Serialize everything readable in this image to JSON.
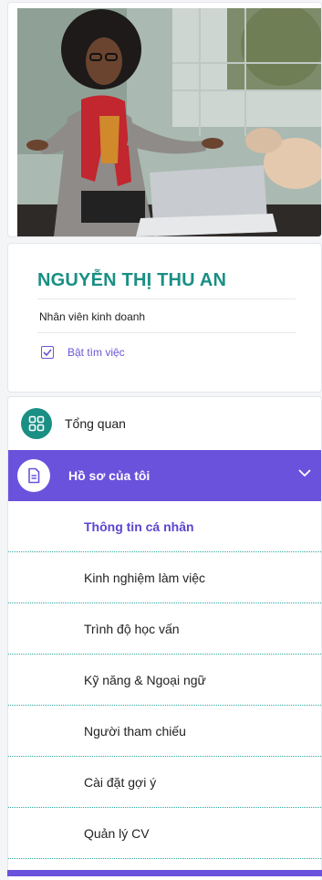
{
  "profile": {
    "name": "NGUYỄN THỊ THU AN",
    "job_title": "Nhân viên kinh doanh",
    "job_search_label": "Bật tìm việc",
    "job_search_enabled": true
  },
  "menu": {
    "overview_label": "Tổng quan",
    "my_profile_label": "Hồ sơ của tôi",
    "sub_items": [
      {
        "label": "Thông tin cá nhân"
      },
      {
        "label": "Kinh nghiệm làm việc"
      },
      {
        "label": "Trình độ học vấn"
      },
      {
        "label": "Kỹ năng & Ngoại ngữ"
      },
      {
        "label": "Người tham chiếu"
      },
      {
        "label": "Cài đặt gợi ý"
      },
      {
        "label": "Quản lý CV"
      }
    ]
  },
  "colors": {
    "teal": "#1a8f84",
    "purple": "#6b52dc",
    "active_text": "#5a46cf"
  }
}
